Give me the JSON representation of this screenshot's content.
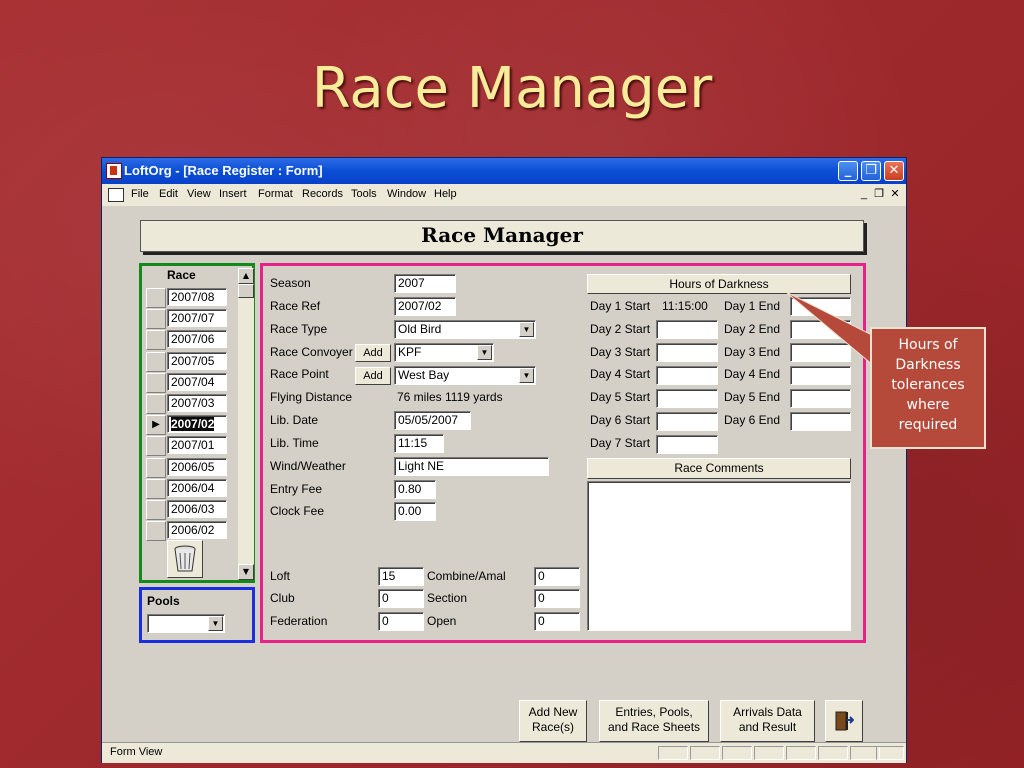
{
  "slide": {
    "title": "Race Manager"
  },
  "window": {
    "title": "LoftOrg - [Race Register : Form]",
    "controls": {
      "minimize": "_",
      "restore": "❐",
      "close": "✕"
    },
    "menu": [
      "File",
      "Edit",
      "View",
      "Insert",
      "Format",
      "Records",
      "Tools",
      "Window",
      "Help"
    ],
    "mdi_controls": {
      "minimize": "_",
      "restore": "❐",
      "close": "✕"
    }
  },
  "form": {
    "header": "Race Manager",
    "race_list": {
      "header": "Race",
      "items": [
        "2007/08",
        "2007/07",
        "2007/06",
        "2007/05",
        "2007/04",
        "2007/03",
        "2007/02",
        "2007/01",
        "2006/05",
        "2006/04",
        "2006/03",
        "2006/02"
      ],
      "selected": "2007/02",
      "delete_icon": "trash-icon"
    },
    "pools": {
      "label": "Pools",
      "value": ""
    },
    "fields": {
      "season": {
        "label": "Season",
        "value": "2007"
      },
      "race_ref": {
        "label": "Race Ref",
        "value": "2007/02"
      },
      "race_type": {
        "label": "Race Type",
        "value": "Old Bird"
      },
      "race_convoyer": {
        "label": "Race Convoyer",
        "add": "Add",
        "value": "KPF"
      },
      "race_point": {
        "label": "Race Point",
        "add": "Add",
        "value": "West Bay"
      },
      "flying_distance": {
        "label": "Flying Distance",
        "value": "76 miles 1119 yards"
      },
      "lib_date": {
        "label": "Lib. Date",
        "value": "05/05/2007"
      },
      "lib_time": {
        "label": "Lib. Time",
        "value": "11:15"
      },
      "wind_weather": {
        "label": "Wind/Weather",
        "value": "Light NE"
      },
      "entry_fee": {
        "label": "Entry Fee",
        "value": "0.80"
      },
      "clock_fee": {
        "label": "Clock Fee",
        "value": "0.00"
      },
      "loft": {
        "label": "Loft",
        "value": "15"
      },
      "club": {
        "label": "Club",
        "value": "0"
      },
      "federation": {
        "label": "Federation",
        "value": "0"
      },
      "combine_amal": {
        "label": "Combine/Amal",
        "value": "0"
      },
      "section": {
        "label": "Section",
        "value": "0"
      },
      "open": {
        "label": "Open",
        "value": "0"
      }
    },
    "darkness": {
      "header": "Hours of Darkness",
      "day1_start": {
        "label": "Day 1 Start",
        "value": "11:15:00"
      },
      "day1_end": {
        "label": "Day 1 End",
        "value": ""
      },
      "day2_start": {
        "label": "Day 2 Start",
        "value": ""
      },
      "day2_end": {
        "label": "Day 2 End",
        "value": ""
      },
      "day3_start": {
        "label": "Day 3 Start",
        "value": ""
      },
      "day3_end": {
        "label": "Day 3 End",
        "value": ""
      },
      "day4_start": {
        "label": "Day 4 Start",
        "value": ""
      },
      "day4_end": {
        "label": "Day 4 End",
        "value": ""
      },
      "day5_start": {
        "label": "Day 5 Start",
        "value": ""
      },
      "day5_end": {
        "label": "Day 5 End",
        "value": ""
      },
      "day6_start": {
        "label": "Day 6 Start",
        "value": ""
      },
      "day6_end": {
        "label": "Day 6 End",
        "value": ""
      },
      "day7_start": {
        "label": "Day 7 Start",
        "value": ""
      }
    },
    "comments": {
      "header": "Race Comments",
      "value": ""
    },
    "buttons": {
      "add_new": "Add New\nRace(s)",
      "entries": "Entries, Pools,\nand Race Sheets",
      "arrivals": "Arrivals Data\nand Result",
      "exit_icon": "exit-door-icon"
    }
  },
  "status": {
    "text": "Form View"
  },
  "callout": {
    "text": "Hours of\nDarkness\ntolerances\nwhere\nrequired"
  },
  "colors": {
    "race_box": "#148a1c",
    "pools_box": "#1a2ee0",
    "details_box": "#e8208a",
    "background": "#a3282b",
    "title": "#f6ec9a"
  }
}
